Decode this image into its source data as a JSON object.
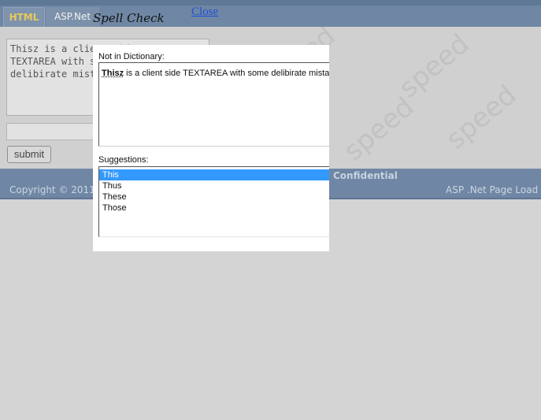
{
  "tabs": [
    {
      "label": "HTML"
    },
    {
      "label": "ASP.Net"
    }
  ],
  "source": {
    "textarea_text": "Thisz is a client side\nTEXTAREA with some\ndelibirate mistakes",
    "submit_label": "submit"
  },
  "footer": {
    "confidential": "Confidential",
    "copyright": "Copyright © 2011",
    "page_load": "ASP .Net Page Load Time"
  },
  "watermark": "speed",
  "dialog": {
    "title": "Spell Check",
    "close_label": "Close",
    "not_in_dictionary_label": "Not in Dictionary:",
    "misspelled_word": "Thisz",
    "context_rest": " is a client side TEXTAREA with some delibirate mistakes",
    "suggestions_label": "Suggestions:",
    "suggestions": [
      "This",
      "Thus",
      "These",
      "Those"
    ],
    "selected_index": 0
  },
  "colors": {
    "header_bar": "#6f87a4",
    "active_tab_text": "#e8c95a",
    "selection": "#3399ff",
    "close_link": "#1f4fd6"
  }
}
